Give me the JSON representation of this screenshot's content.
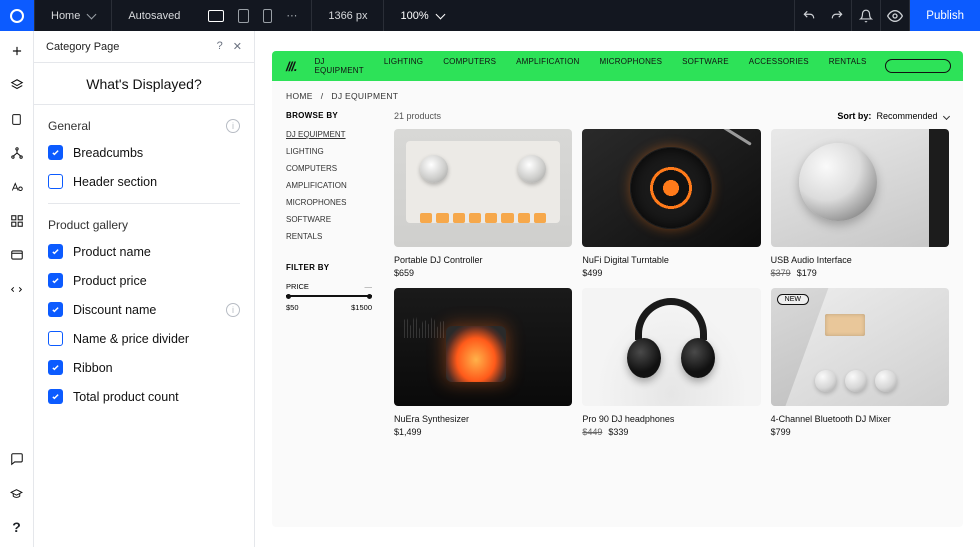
{
  "topbar": {
    "page_selector": "Home",
    "autosaved": "Autosaved",
    "viewport_px": "1366 px",
    "zoom": "100%",
    "publish": "Publish"
  },
  "panel": {
    "title": "Category Page",
    "section_title": "What's Displayed?",
    "sections": {
      "general": {
        "label": "General"
      },
      "gallery": {
        "label": "Product gallery"
      }
    },
    "items": {
      "breadcrumbs": "Breadcumbs",
      "header_section": "Header section",
      "product_name": "Product name",
      "product_price": "Product price",
      "discount_name": "Discount name",
      "divider": "Name & price divider",
      "ribbon": "Ribbon",
      "total_count": "Total product count"
    }
  },
  "store": {
    "nav": [
      "DJ EQUIPMENT",
      "LIGHTING",
      "COMPUTERS",
      "AMPLIFICATION",
      "MICROPHONES",
      "SOFTWARE",
      "ACCESSORIES",
      "RENTALS"
    ],
    "crumb_home": "HOME",
    "crumb_sep": "/",
    "crumb_current": "DJ EQUIPMENT",
    "browse_by": "BROWSE BY",
    "categories": [
      "DJ EQUIPMENT",
      "LIGHTING",
      "COMPUTERS",
      "AMPLIFICATION",
      "MICROPHONES",
      "SOFTWARE",
      "RENTALS"
    ],
    "filter_by": "FILTER BY",
    "price_label": "PRICE",
    "price_min": "$50",
    "price_max": "$1500",
    "count": "21 products",
    "sort_label": "Sort by:",
    "sort_value": "Recommended",
    "badge_new": "NEW",
    "products": [
      {
        "name": "Portable DJ Controller",
        "price": "$659"
      },
      {
        "name": "NuFi Digital Turntable",
        "price": "$499"
      },
      {
        "name": "USB Audio Interface",
        "old": "$379",
        "price": "$179"
      },
      {
        "name": "NuEra Synthesizer",
        "price": "$1,499"
      },
      {
        "name": "Pro 90 DJ headphones",
        "old": "$449",
        "price": "$339"
      },
      {
        "name": "4-Channel Bluetooth DJ Mixer",
        "price": "$799"
      }
    ]
  }
}
